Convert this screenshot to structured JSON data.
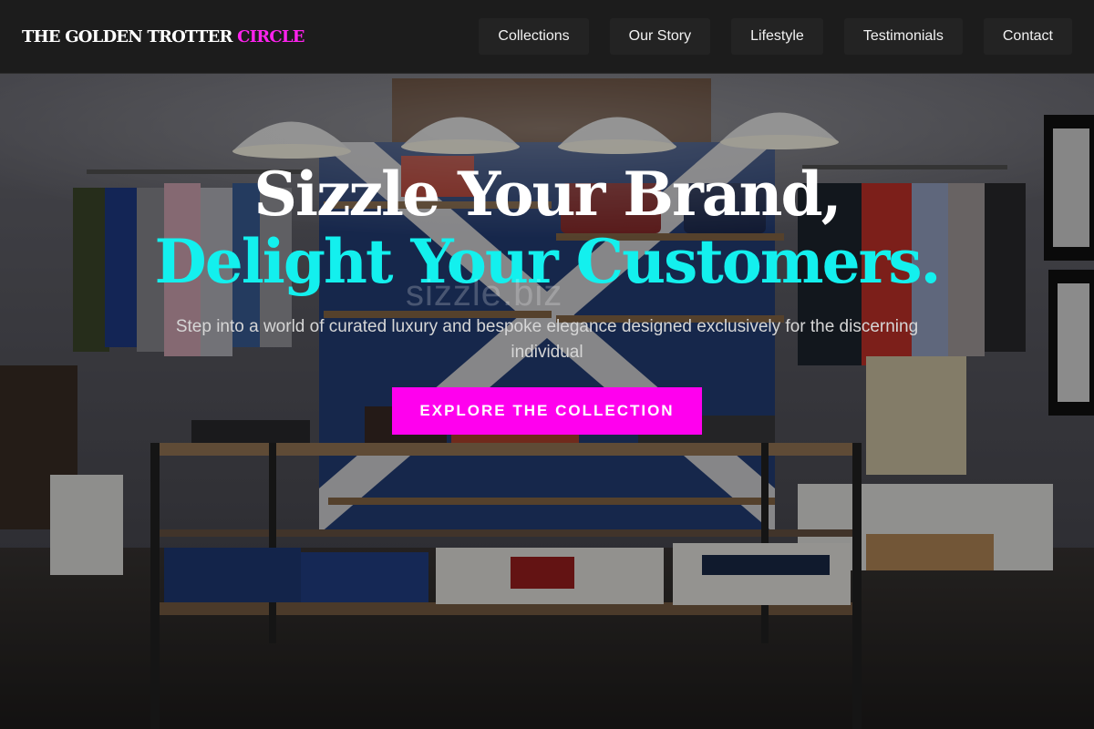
{
  "brand": {
    "name": "THE GOLDEN TROTTER",
    "accent": "CIRCLE",
    "accent_color": "#ff22ee"
  },
  "nav": {
    "items": [
      {
        "label": "Collections"
      },
      {
        "label": "Our Story"
      },
      {
        "label": "Lifestyle"
      },
      {
        "label": "Testimonials"
      },
      {
        "label": "Contact"
      }
    ]
  },
  "hero": {
    "headline_line1": "Sizzle Your Brand,",
    "headline_line2": "Delight Your Customers.",
    "headline_accent_color": "#13f0ee",
    "subtext": "Step into a world of curated luxury and bespoke elegance designed exclusively for the discerning individual",
    "cta_label": "EXPLORE THE COLLECTION",
    "cta_color": "#ff00ee",
    "watermark": "sizzle.biz",
    "background": "clothing-store-interior-image"
  }
}
